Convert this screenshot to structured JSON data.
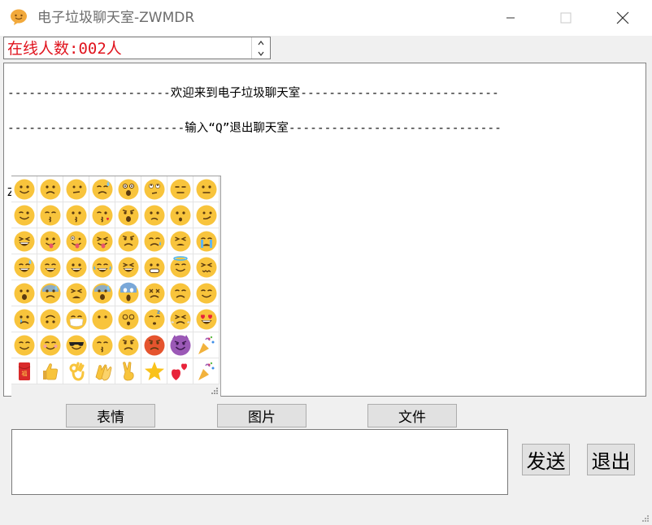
{
  "window": {
    "title": "电子垃圾聊天室-ZWMDR",
    "icons": [
      "app-icon",
      "minimize-icon",
      "maximize-icon",
      "close-icon"
    ]
  },
  "online": {
    "text": "在线人数:002人",
    "color": "#e0141e"
  },
  "chat": {
    "lines": [
      "-----------------------欢迎来到电子垃圾聊天室----------------------------",
      "-------------------------输入“Q”退出聊天室------------------------------"
    ],
    "fragment": "Z"
  },
  "emoji_panel": {
    "icons": [
      "smile",
      "frown",
      "unamused",
      "downcast-sweat",
      "astonished",
      "eye-roll",
      "expressionless",
      "neutral",
      "wink",
      "kissing-smile",
      "kissing",
      "kiss-heart",
      "anguished",
      "confused",
      "hushed",
      "smirk",
      "grin-squint",
      "tongue",
      "zany",
      "tongue-squint",
      "worried",
      "pensive-sweat",
      "tired",
      "crying",
      "sweat-smile",
      "grin",
      "big-grin",
      "joy",
      "beaming",
      "grin-teeth",
      "innocent",
      "confounded",
      "frowning-open",
      "anxious-sweat",
      "weary",
      "cold-sweat",
      "scream",
      "persevere",
      "disappointed",
      "relieved",
      "sad-tear",
      "upside-down",
      "mask",
      "no-mouth",
      "dizzy",
      "sleeping",
      "triumph",
      "heart-eyes",
      "relieved-2",
      "blush",
      "sunglasses",
      "kiss-closed",
      "angry-2",
      "rage",
      "smiling-devil",
      "party-popper-2",
      "red-envelope",
      "thumbs-up",
      "ok-hand",
      "clap",
      "victory",
      "star",
      "two-hearts",
      "party-popper"
    ],
    "red_envelope_char": "福"
  },
  "toolbar": {
    "emoji_label": "表情",
    "image_label": "图片",
    "file_label": "文件"
  },
  "actions": {
    "send_label": "发送",
    "exit_label": "退出"
  }
}
